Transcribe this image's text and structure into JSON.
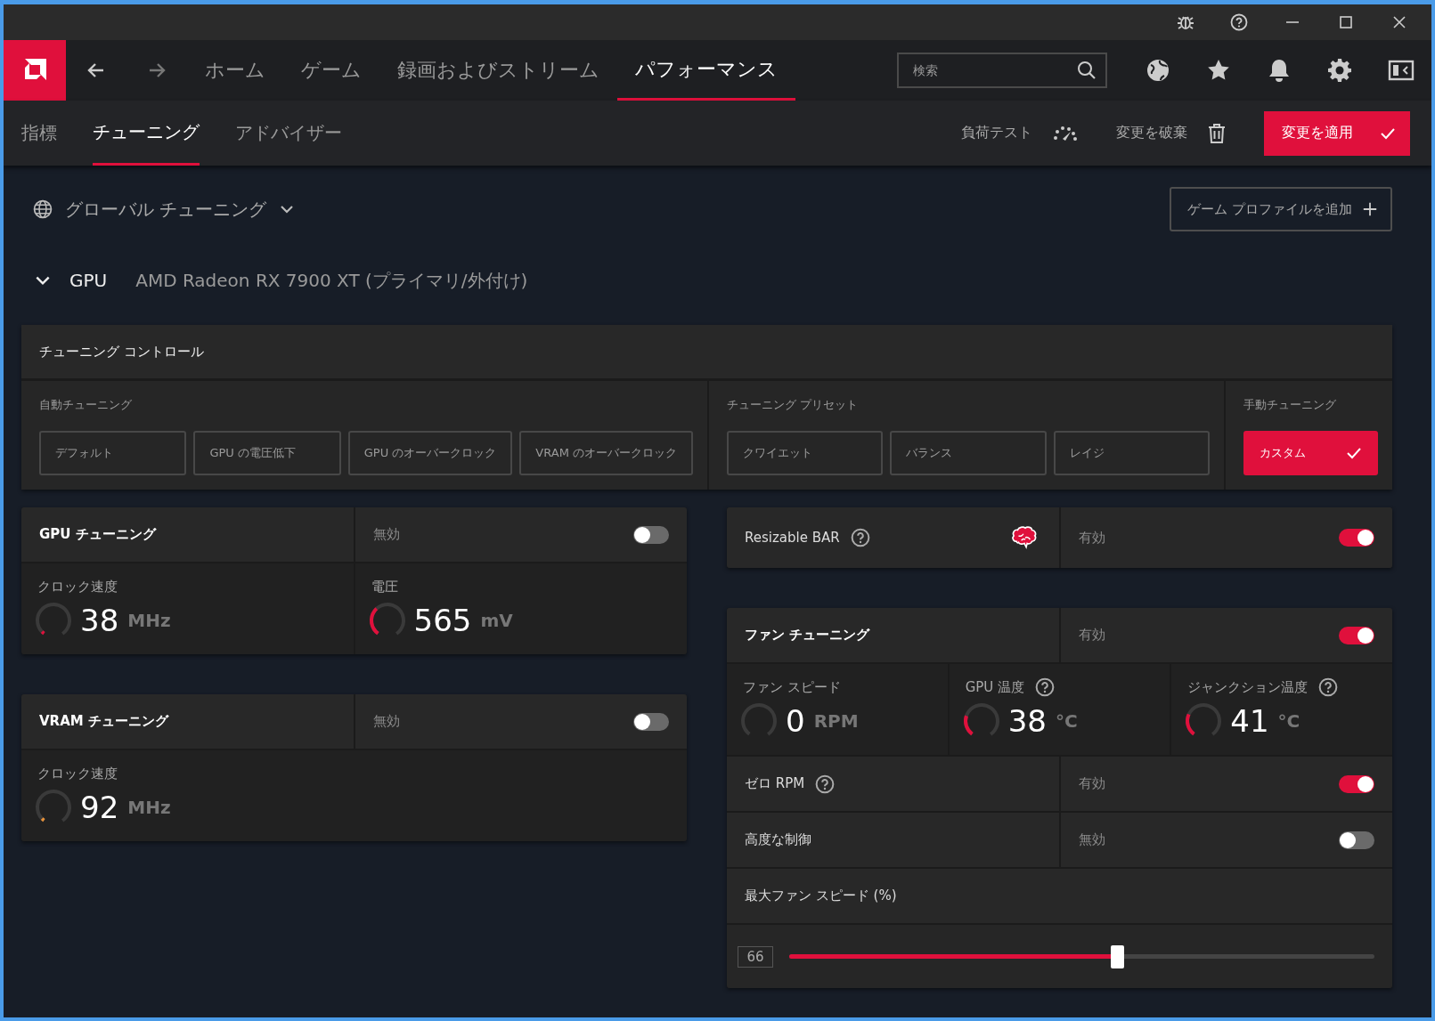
{
  "nav": {
    "tabs": [
      {
        "label": "ホーム",
        "selected": false
      },
      {
        "label": "ゲーム",
        "selected": false
      },
      {
        "label": "録画およびストリーム",
        "selected": false
      },
      {
        "label": "パフォーマンス",
        "selected": true
      }
    ],
    "search": {
      "placeholder": "検索"
    }
  },
  "subnav": {
    "tabs": [
      {
        "label": "指標",
        "selected": false
      },
      {
        "label": "チューニング",
        "selected": true
      },
      {
        "label": "アドバイザー",
        "selected": false
      }
    ],
    "actions": [
      {
        "label": "負荷テスト",
        "kind": "stress"
      },
      {
        "label": "変更を破棄",
        "kind": "discard"
      }
    ],
    "apply_button": "変更を適用"
  },
  "profile": {
    "label": "グローバル チューニング",
    "add_button": "ゲーム プロファイルを追加"
  },
  "device": {
    "expanded": true,
    "category": "GPU",
    "name": "AMD Radeon RX 7900 XT (プライマリ/外付け)"
  },
  "tuning_control": {
    "title": "チューニング コントロール",
    "groups": [
      {
        "label": "自動チューニング",
        "options": [
          {
            "label": "デフォルト",
            "selected": false
          },
          {
            "label": "GPU の電圧低下",
            "selected": false
          },
          {
            "label": "GPU のオーバークロック",
            "selected": false
          },
          {
            "label": "VRAM のオーバークロック",
            "selected": false
          }
        ]
      },
      {
        "label": "チューニング プリセット",
        "options": [
          {
            "label": "クワイエット",
            "selected": false
          },
          {
            "label": "バランス",
            "selected": false
          },
          {
            "label": "レイジ",
            "selected": false
          }
        ]
      },
      {
        "label": "手動チューニング",
        "options": [
          {
            "label": "カスタム",
            "selected": true
          }
        ]
      }
    ]
  },
  "gpu_tuning": {
    "title": "GPU チューニング",
    "state_label": "無効",
    "on": false,
    "metrics": [
      {
        "label": "クロック速度",
        "value": "38",
        "unit": "MHz",
        "level": 0.02,
        "color": "#e0103c"
      },
      {
        "label": "電圧",
        "value": "565",
        "unit": "mV",
        "level": 0.35,
        "color": "#e0103c"
      }
    ]
  },
  "vram_tuning": {
    "title": "VRAM チューニング",
    "state_label": "無効",
    "on": false,
    "metrics": [
      {
        "label": "クロック速度",
        "value": "92",
        "unit": "MHz",
        "level": 0.03,
        "color": "#e8923a"
      }
    ]
  },
  "resizable_bar": {
    "title": "Resizable BAR",
    "help": true,
    "state_label": "有効",
    "on": true
  },
  "fan_tuning": {
    "title": "ファン チューニング",
    "state_label": "有効",
    "on": true,
    "metrics": [
      {
        "label": "ファン スピード",
        "help": false,
        "value": "0",
        "unit": "RPM"
      },
      {
        "label": "GPU 温度",
        "help": true,
        "value": "38",
        "unit": "°C",
        "level": 0.25,
        "color": "#e0103c"
      },
      {
        "label": "ジャンクション温度",
        "help": true,
        "value": "41",
        "unit": "°C",
        "level": 0.27,
        "color": "#e0103c"
      }
    ],
    "settings": [
      {
        "label": "ゼロ RPM",
        "help": true,
        "state_label": "有効",
        "on": true
      },
      {
        "label": "高度な制御",
        "help": false,
        "state_label": "無効",
        "on": false
      }
    ],
    "max_speed": {
      "label": "最大ファン スピード (%)",
      "value": "66",
      "level": 0.56
    }
  }
}
